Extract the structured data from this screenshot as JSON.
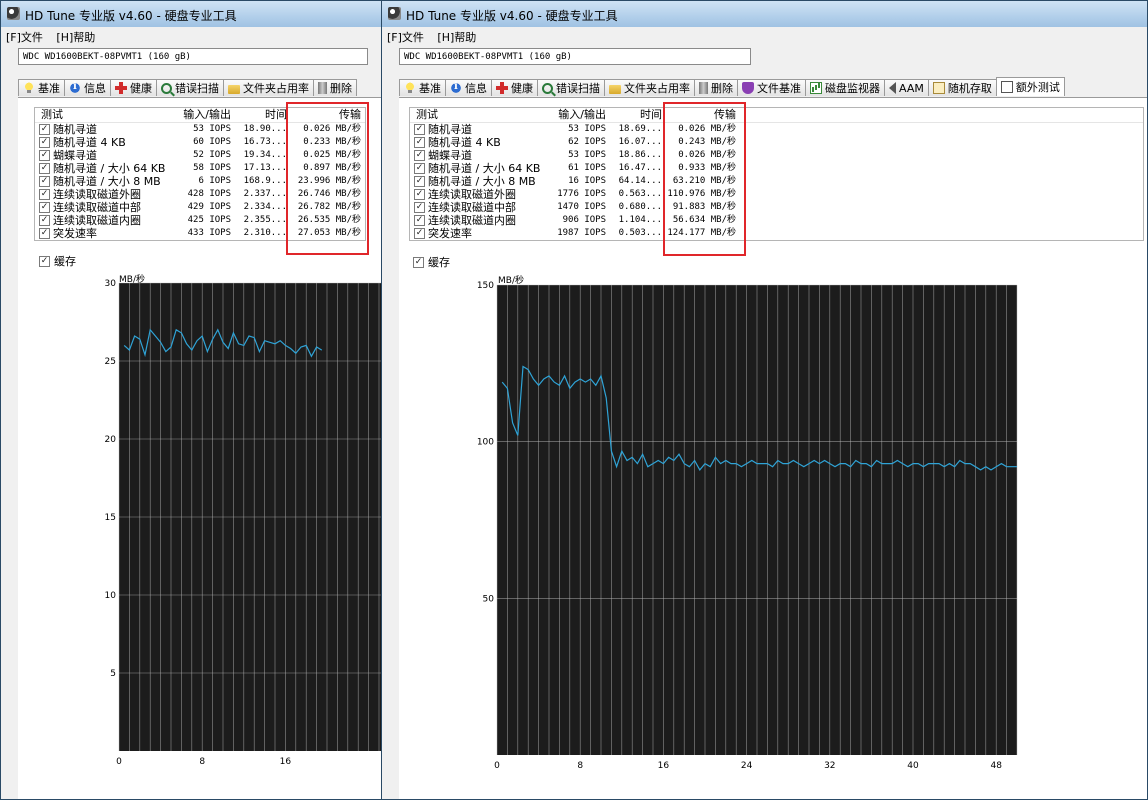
{
  "colors": {
    "accent_red": "#e0262a",
    "plot_line": "#2fa3d6",
    "plot_bg": "#1c1c1c",
    "grid": "#b8b8b8"
  },
  "windows": [
    {
      "title": "HD Tune 专业版 v4.60 - 硬盘专业工具",
      "menu": [
        "[F]文件",
        "[H]帮助"
      ],
      "drive": "WDC WD1600BEKT-08PVMT1    (160 gB)",
      "tabs": [
        {
          "label": "基准",
          "icon": "bulb-icon"
        },
        {
          "label": "信息",
          "icon": "info-icon"
        },
        {
          "label": "健康",
          "icon": "health-cross-icon"
        },
        {
          "label": "错误扫描",
          "icon": "magnifier-icon"
        },
        {
          "label": "文件夹占用率",
          "icon": "folder-icon"
        },
        {
          "label": "删除",
          "icon": "trash-icon"
        }
      ],
      "results": {
        "headers": [
          "测试",
          "输入/输出",
          "时间",
          "传输"
        ],
        "rows": [
          {
            "name": "随机寻道",
            "io": "53 IOPS",
            "time": "18.90...",
            "rate": "0.026 MB/秒"
          },
          {
            "name": "随机寻道 4 KB",
            "io": "60 IOPS",
            "time": "16.73...",
            "rate": "0.233 MB/秒"
          },
          {
            "name": "蝴蝶寻道",
            "io": "52 IOPS",
            "time": "19.34...",
            "rate": "0.025 MB/秒"
          },
          {
            "name": "随机寻道 / 大小 64 KB",
            "io": "58 IOPS",
            "time": "17.13...",
            "rate": "0.897 MB/秒"
          },
          {
            "name": "随机寻道 / 大小 8 MB",
            "io": "6 IOPS",
            "time": "168.9...",
            "rate": "23.996 MB/秒"
          },
          {
            "name": "连续读取磁道外圈",
            "io": "428 IOPS",
            "time": "2.337...",
            "rate": "26.746 MB/秒"
          },
          {
            "name": "连续读取磁道中部",
            "io": "429 IOPS",
            "time": "2.334...",
            "rate": "26.782 MB/秒"
          },
          {
            "name": "连续读取磁道内圈",
            "io": "425 IOPS",
            "time": "2.355...",
            "rate": "26.535 MB/秒"
          },
          {
            "name": "突发速率",
            "io": "433 IOPS",
            "time": "2.310...",
            "rate": "27.053 MB/秒"
          }
        ]
      },
      "cache_label": "缓存",
      "chart_data": {
        "type": "line",
        "ylabel": "MB/秒",
        "ylim": [
          0,
          30
        ],
        "yticks": [
          30,
          25,
          20,
          15,
          10,
          5
        ],
        "xlim": [
          0,
          50
        ],
        "xticks": [
          0,
          8,
          16
        ],
        "grid": true,
        "x": [
          0.5,
          1,
          1.5,
          2,
          2.5,
          3,
          3.5,
          4,
          4.5,
          5,
          5.5,
          6,
          6.5,
          7,
          7.5,
          8,
          8.5,
          9,
          9.5,
          10,
          10.5,
          11,
          11.5,
          12,
          12.5,
          13,
          13.5,
          14,
          14.5,
          15,
          15.5,
          16,
          16.5,
          17,
          17.5,
          18,
          18.5,
          19,
          19.5
        ],
        "values": [
          26.0,
          25.7,
          26.6,
          26.4,
          25.4,
          27.0,
          26.6,
          26.2,
          25.6,
          25.9,
          27.0,
          26.8,
          26.1,
          25.7,
          26.3,
          26.6,
          25.6,
          26.4,
          27.0,
          26.2,
          25.8,
          26.8,
          26.1,
          26.0,
          26.6,
          26.5,
          25.6,
          26.3,
          26.2,
          26.1,
          26.3,
          26.0,
          25.8,
          25.5,
          25.9,
          26.0,
          25.3,
          25.9,
          25.7
        ]
      }
    },
    {
      "title": "HD Tune 专业版 v4.60 - 硬盘专业工具",
      "menu": [
        "[F]文件",
        "[H]帮助"
      ],
      "drive": "WDC WD1600BEKT-08PVMT1    (160 gB)",
      "tabs": [
        {
          "label": "基准",
          "icon": "bulb-icon"
        },
        {
          "label": "信息",
          "icon": "info-icon"
        },
        {
          "label": "健康",
          "icon": "health-cross-icon"
        },
        {
          "label": "错误扫描",
          "icon": "magnifier-icon"
        },
        {
          "label": "文件夹占用率",
          "icon": "folder-icon"
        },
        {
          "label": "删除",
          "icon": "trash-icon"
        },
        {
          "label": "文件基准",
          "icon": "shield-icon"
        },
        {
          "label": "磁盘监视器",
          "icon": "chart-icon"
        },
        {
          "label": "AAM",
          "icon": "speaker-icon"
        },
        {
          "label": "随机存取",
          "icon": "dice-icon"
        },
        {
          "label": "额外测试",
          "icon": "extra-tests-icon",
          "active": true
        }
      ],
      "results": {
        "headers": [
          "测试",
          "输入/输出",
          "时间",
          "传输"
        ],
        "rows": [
          {
            "name": "随机寻道",
            "io": "53 IOPS",
            "time": "18.69...",
            "rate": "0.026 MB/秒"
          },
          {
            "name": "随机寻道 4 KB",
            "io": "62 IOPS",
            "time": "16.07...",
            "rate": "0.243 MB/秒"
          },
          {
            "name": "蝴蝶寻道",
            "io": "53 IOPS",
            "time": "18.86...",
            "rate": "0.026 MB/秒"
          },
          {
            "name": "随机寻道 / 大小 64 KB",
            "io": "61 IOPS",
            "time": "16.47...",
            "rate": "0.933 MB/秒"
          },
          {
            "name": "随机寻道 / 大小 8 MB",
            "io": "16 IOPS",
            "time": "64.14...",
            "rate": "63.210 MB/秒"
          },
          {
            "name": "连续读取磁道外圈",
            "io": "1776 IOPS",
            "time": "0.563...",
            "rate": "110.976 MB/秒"
          },
          {
            "name": "连续读取磁道中部",
            "io": "1470 IOPS",
            "time": "0.680...",
            "rate": "91.883 MB/秒"
          },
          {
            "name": "连续读取磁道内圈",
            "io": "906 IOPS",
            "time": "1.104...",
            "rate": "56.634 MB/秒"
          },
          {
            "name": "突发速率",
            "io": "1987 IOPS",
            "time": "0.503...",
            "rate": "124.177 MB/秒"
          }
        ]
      },
      "cache_label": "缓存",
      "chart_data": {
        "type": "line",
        "ylabel": "MB/秒",
        "ylim": [
          0,
          150
        ],
        "yticks": [
          150,
          100,
          50
        ],
        "xlim": [
          0,
          50
        ],
        "xticks": [
          0,
          8,
          16,
          24,
          32,
          40,
          48
        ],
        "grid": true,
        "x": [
          0.5,
          1,
          1.5,
          2,
          2.5,
          3,
          3.5,
          4,
          4.5,
          5,
          5.5,
          6,
          6.5,
          7,
          7.5,
          8,
          8.5,
          9,
          9.5,
          10,
          10.5,
          11,
          11.5,
          12,
          12.5,
          13,
          13.5,
          14,
          14.5,
          15,
          15.5,
          16,
          16.5,
          17,
          17.5,
          18,
          18.5,
          19,
          19.5,
          20,
          20.5,
          21,
          21.5,
          22,
          22.5,
          23,
          23.5,
          24,
          24.5,
          25,
          25.5,
          26,
          26.5,
          27,
          27.5,
          28,
          28.5,
          29,
          29.5,
          30,
          30.5,
          31,
          31.5,
          32,
          32.5,
          33,
          33.5,
          34,
          34.5,
          35,
          35.5,
          36,
          36.5,
          37,
          37.5,
          38,
          38.5,
          39,
          39.5,
          40,
          40.5,
          41,
          41.5,
          42,
          42.5,
          43,
          43.5,
          44,
          44.5,
          45,
          45.5,
          46,
          46.5,
          47,
          47.5,
          48,
          48.5,
          49,
          49.5,
          50
        ],
        "values": [
          119,
          117,
          106,
          102,
          124,
          123,
          120,
          118,
          120,
          121,
          119,
          118,
          121,
          117,
          119,
          120,
          119,
          120,
          118,
          121,
          114,
          97,
          92,
          97,
          94,
          95,
          93,
          96,
          92,
          93,
          94,
          93,
          95,
          94,
          96,
          93,
          92,
          94,
          91,
          93,
          92,
          95,
          93,
          94,
          93,
          93,
          92,
          93,
          94,
          93,
          93,
          93,
          92,
          94,
          93,
          93,
          94,
          93,
          92,
          93,
          94,
          93,
          94,
          93,
          92,
          93,
          93,
          92,
          94,
          93,
          93,
          92,
          94,
          93,
          93,
          93,
          94,
          93,
          92,
          93,
          93,
          92,
          93,
          93,
          93,
          92,
          93,
          92,
          94,
          93,
          93,
          92,
          91,
          92,
          91,
          92,
          93,
          92,
          92,
          92
        ]
      }
    }
  ]
}
